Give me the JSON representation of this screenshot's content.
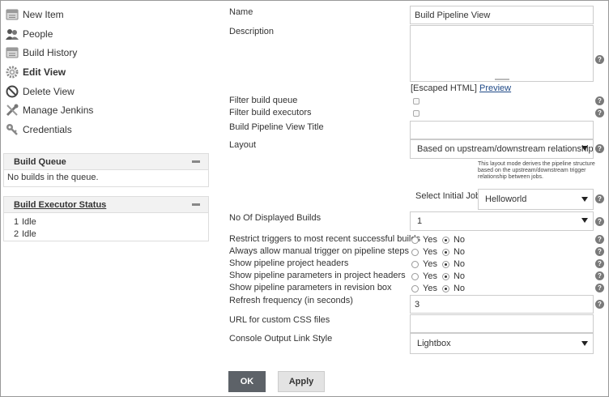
{
  "sidebar": {
    "tasks": [
      {
        "label": "New Item",
        "icon": "notepad-icon"
      },
      {
        "label": "People",
        "icon": "people-icon"
      },
      {
        "label": "Build History",
        "icon": "notepad-icon"
      },
      {
        "label": "Edit View",
        "icon": "gear-icon"
      },
      {
        "label": "Delete View",
        "icon": "no-entry-icon"
      },
      {
        "label": "Manage Jenkins",
        "icon": "wrench-icon"
      },
      {
        "label": "Credentials",
        "icon": "key-icon"
      }
    ],
    "build_queue": {
      "title": "Build Queue",
      "empty_text": "No builds in the queue."
    },
    "executor_status": {
      "title": "Build Executor Status",
      "executors": [
        {
          "num": "1",
          "status": "Idle"
        },
        {
          "num": "2",
          "status": "Idle"
        }
      ]
    }
  },
  "form": {
    "name": {
      "label": "Name",
      "value": "Build Pipeline View"
    },
    "description": {
      "label": "Description",
      "escaped_html": "[Escaped HTML]",
      "preview": "Preview"
    },
    "filter_queue": {
      "label": "Filter build queue"
    },
    "filter_executors": {
      "label": "Filter build executors"
    },
    "title": {
      "label": "Build Pipeline View Title",
      "value": ""
    },
    "layout": {
      "label": "Layout",
      "value": "Based on upstream/downstream relationship",
      "help_text": "This layout mode derives the pipeline structure based on the upstream/downstream trigger relationship between jobs."
    },
    "initial_job": {
      "label": "Select Initial Job",
      "value": "Helloworld"
    },
    "displayed_builds": {
      "label": "No Of Displayed Builds",
      "value": "1"
    },
    "radio_options": [
      {
        "label": "Restrict triggers to most recent successful builds",
        "yes": "Yes",
        "no": "No"
      },
      {
        "label": "Always allow manual trigger on pipeline steps",
        "yes": "Yes",
        "no": "No"
      },
      {
        "label": "Show pipeline project headers",
        "yes": "Yes",
        "no": "No"
      },
      {
        "label": "Show pipeline parameters in project headers",
        "yes": "Yes",
        "no": "No"
      },
      {
        "label": "Show pipeline parameters in revision box",
        "yes": "Yes",
        "no": "No"
      }
    ],
    "refresh": {
      "label": "Refresh frequency (in seconds)",
      "value": "3"
    },
    "css_url": {
      "label": "URL for custom CSS files",
      "value": ""
    },
    "console_style": {
      "label": "Console Output Link Style",
      "value": "Lightbox"
    },
    "help_glyph": "?"
  },
  "buttons": {
    "ok": "OK",
    "apply": "Apply"
  }
}
